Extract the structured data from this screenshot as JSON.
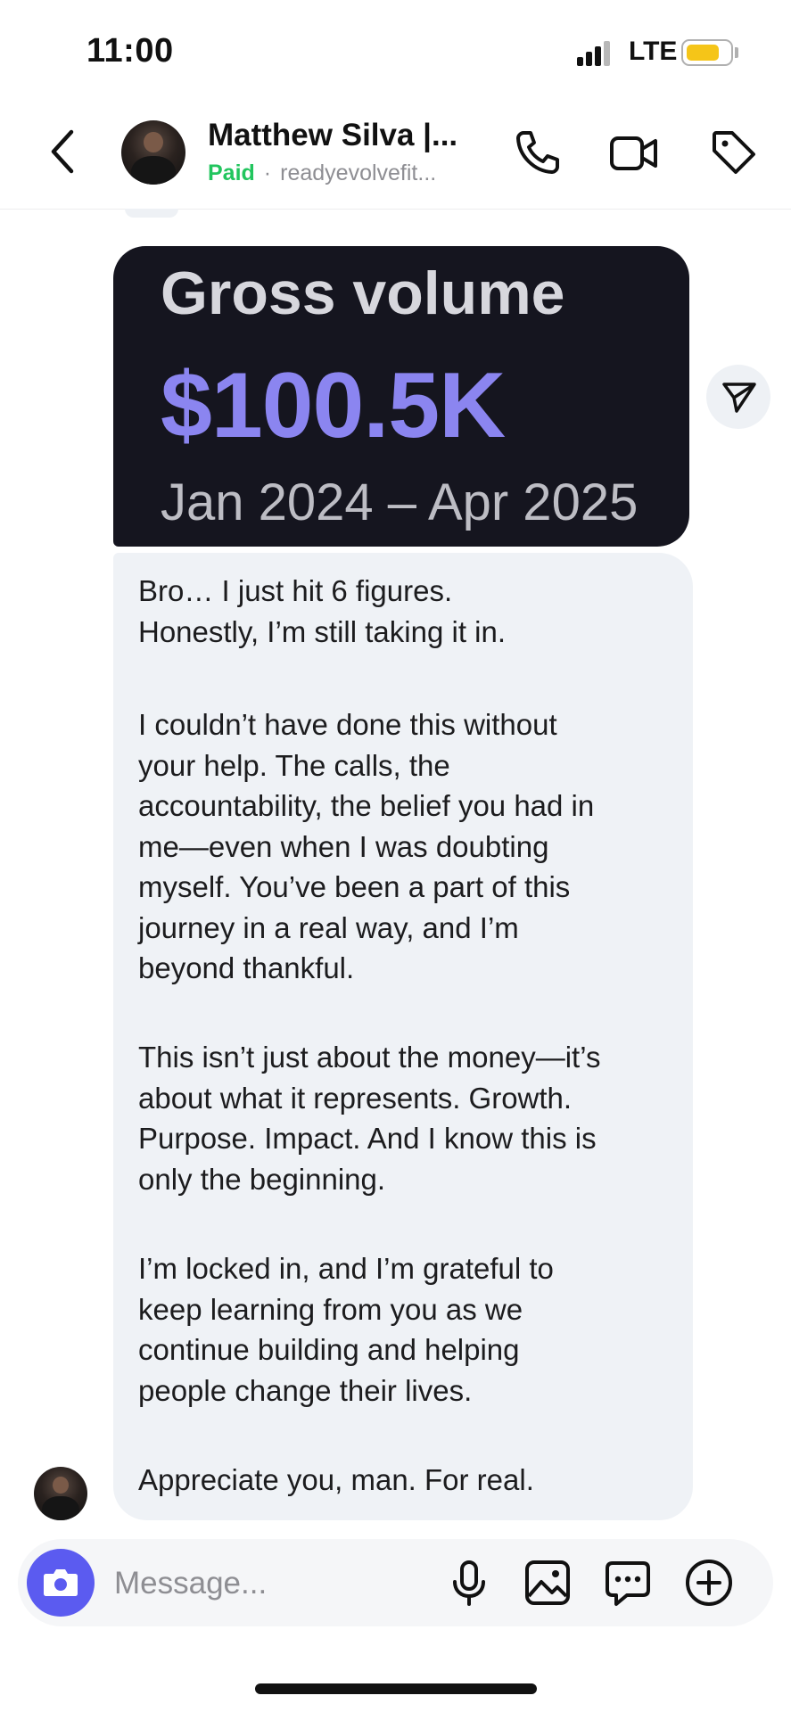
{
  "status_bar": {
    "time": "11:00",
    "network": "LTE",
    "battery_color": "#f5c518"
  },
  "header": {
    "contact_name": "Matthew Silva |...",
    "status": "Paid",
    "separator": "·",
    "handle": "readyevolvefit...",
    "icons": [
      "chevron-left-icon",
      "phone-icon",
      "video-icon",
      "tag-icon"
    ]
  },
  "attachment_image": {
    "title": "Gross volume",
    "value": "$100.5K",
    "date_range": "Jan 2024 – Apr 2025",
    "value_color": "#8b85f0"
  },
  "message": {
    "paragraphs": [
      "Bro… I just hit 6 figures.\nHonestly, I’m still taking it in.",
      "I couldn’t have done this without\nyour help. The calls, the\naccountability, the belief you had in\nme—even when I was doubting\nmyself. You’ve been a part of this\njourney in a real way, and I’m\nbeyond thankful.",
      "This isn’t just about the money—it’s\nabout what it represents. Growth.\nPurpose. Impact. And I know this is\nonly the beginning.",
      "I’m locked in, and I’m grateful to\nkeep learning from you as we\ncontinue building and helping\npeople change their lives.",
      "Appreciate you, man. For real."
    ]
  },
  "composer": {
    "placeholder": "Message...",
    "icons": [
      "camera-icon",
      "microphone-icon",
      "image-icon",
      "chat-bubble-icon",
      "plus-icon"
    ],
    "accent_color": "#5b5bf0"
  },
  "colors": {
    "paid_green": "#22c55e",
    "bubble_bg": "#eff2f6"
  }
}
